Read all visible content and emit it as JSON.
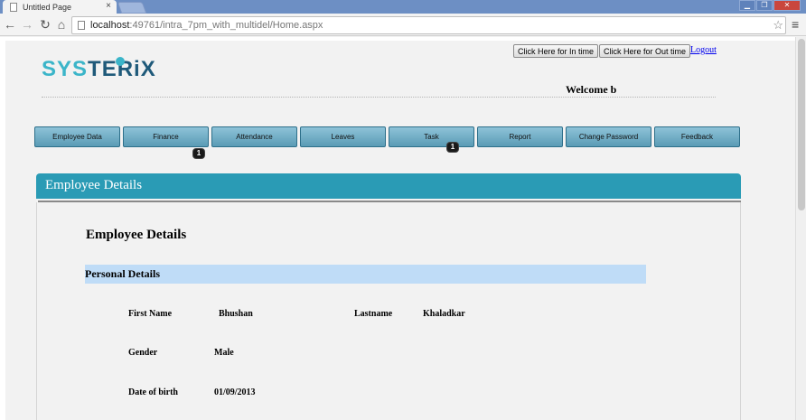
{
  "browser": {
    "tab_title": "Untitled Page",
    "tab_close": "×",
    "url_host": "localhost",
    "url_rest": ":49761/intra_7pm_with_multidel/Home.aspx"
  },
  "header": {
    "in_time_button": "Click Here for In time",
    "out_time_button": "Click Here for Out time",
    "logout_link": "Logout",
    "logo_part1": "SYS",
    "logo_part2": "TERiX",
    "welcome": "Welcome b"
  },
  "menu": {
    "items": [
      {
        "label": "Employee  Data"
      },
      {
        "label": "Finance"
      },
      {
        "label": "Attendance"
      },
      {
        "label": "Leaves"
      },
      {
        "label": "Task"
      },
      {
        "label": "Report"
      },
      {
        "label": "Change Password"
      },
      {
        "label": "Feedback"
      }
    ],
    "finance_badge": "1",
    "task_badge": "1"
  },
  "card": {
    "header": "Employee Details",
    "title": "Employee Details",
    "section": "Personal Details"
  },
  "fields": {
    "first_name_label": "First Name",
    "first_name_value": "Bhushan",
    "lastname_label": "Lastname",
    "lastname_value": "Khaladkar",
    "gender_label": "Gender",
    "gender_value": "Male",
    "dob_label": "Date of birth",
    "dob_value": "01/09/2013"
  },
  "colors": {
    "accent": "#2a9bb5",
    "menu_gradient_top": "#8ec3d8",
    "section_bar": "#bfdcf7"
  }
}
